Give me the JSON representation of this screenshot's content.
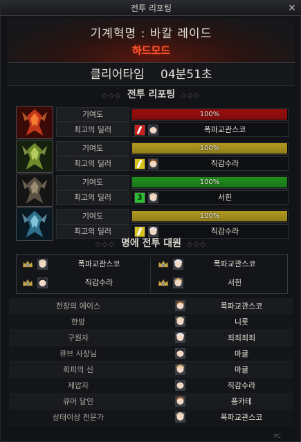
{
  "window": {
    "title": "전투 리포팅"
  },
  "header": {
    "dungeon_name": "기계혁명 : 바칼 레이드",
    "difficulty": "하드모드"
  },
  "clear": {
    "label": "클리어타임",
    "time": "04분51초"
  },
  "section_reporting": "전투 리포팅",
  "section_party": "명에 전투 대원",
  "row_labels": {
    "contribution": "기여도",
    "best_dealer": "최고의 딜러"
  },
  "members": [
    {
      "emblem": "red-dragon-emblem",
      "contribution_text": "100%",
      "contribution": 1.0,
      "bar_color": "#9c0d0d",
      "weapon_color": "#c81e1e",
      "weapon_icon": "slash-icon",
      "dealer": "폭파교관스코"
    },
    {
      "emblem": "green-dragon-emblem",
      "contribution_text": "100%",
      "contribution": 1.0,
      "bar_color": "#b29a1f",
      "weapon_color": "#d8c21c",
      "weapon_icon": "slash-icon",
      "dealer": "직감수라"
    },
    {
      "emblem": "dark-dragon-emblem",
      "contribution_text": "100%",
      "contribution": 1.0,
      "bar_color": "#1f8f1c",
      "weapon_color": "#2fbf35",
      "weapon_icon": "rank-3-icon",
      "dealer": "서힌"
    },
    {
      "emblem": "blue-dragon-emblem",
      "contribution_text": "100%",
      "contribution": 1.0,
      "bar_color": "#b29a1f",
      "weapon_color": "#d8c21c",
      "weapon_icon": "slash-icon",
      "dealer": "직감수라"
    }
  ],
  "party": [
    {
      "name": "폭파교관스코"
    },
    {
      "name": "폭파교관스코"
    },
    {
      "name": "직감수라"
    },
    {
      "name": "서힌"
    }
  ],
  "titles": [
    {
      "title": "전장의 에이스",
      "player": "폭파교관스코"
    },
    {
      "title": "한방",
      "player": "니룻"
    },
    {
      "title": "구원자",
      "player": "죄죄죄죄"
    },
    {
      "title": "큐브 사장님",
      "player": "마귤"
    },
    {
      "title": "회피의 신",
      "player": "마귤"
    },
    {
      "title": "제압자",
      "player": "직감수라"
    },
    {
      "title": "큐어 달인",
      "player": "풍카테"
    },
    {
      "title": "상태이상 전문가",
      "player": "폭파교관스코"
    }
  ],
  "corner": "PC"
}
